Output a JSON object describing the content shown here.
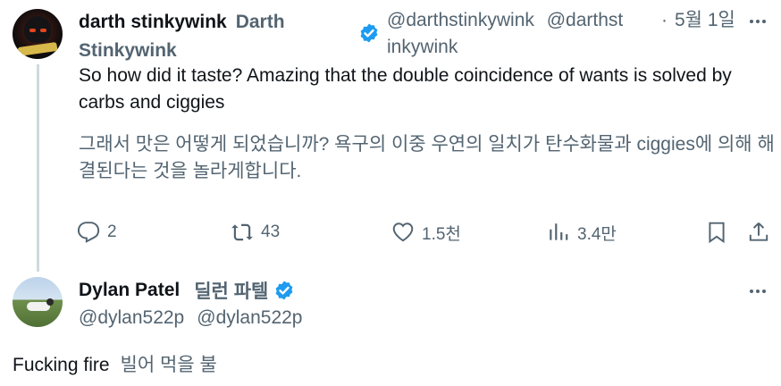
{
  "tweet1": {
    "display_name": "darth stinkywink",
    "alt_name": "Darth Stinkywink",
    "handle": "@darthstinkywink",
    "handle_alt_part1": "@darthst",
    "handle_alt_part2": "inkywink",
    "separator": "·",
    "date": "5월 1일",
    "text": "So how did it taste? Amazing that the double coincidence of wants is solved by carbs and ciggies",
    "translation": "그래서 맛은 어떻게 되었습니까? 욕구의 이중 우연의 일치가 탄수화물과 ciggies에 의해 해결된다는 것을 놀라게합니다.",
    "verified_color": "#1d9bf0",
    "actions": {
      "reply_count": "2",
      "retweet_count": "43",
      "like_count": "1.5천",
      "view_count": "3.4만"
    }
  },
  "tweet2": {
    "display_name": "Dylan Patel",
    "alt_name": "딜런 파텔",
    "handle": "@dylan522p",
    "handle_alt": "@dylan522p",
    "text": "Fucking fire",
    "translation": "빌어 먹을 불",
    "verified_color": "#1d9bf0"
  },
  "icons": [
    "reply-icon",
    "retweet-icon",
    "like-icon",
    "views-icon",
    "bookmark-icon",
    "share-icon",
    "more-icon",
    "verified-badge-icon"
  ]
}
